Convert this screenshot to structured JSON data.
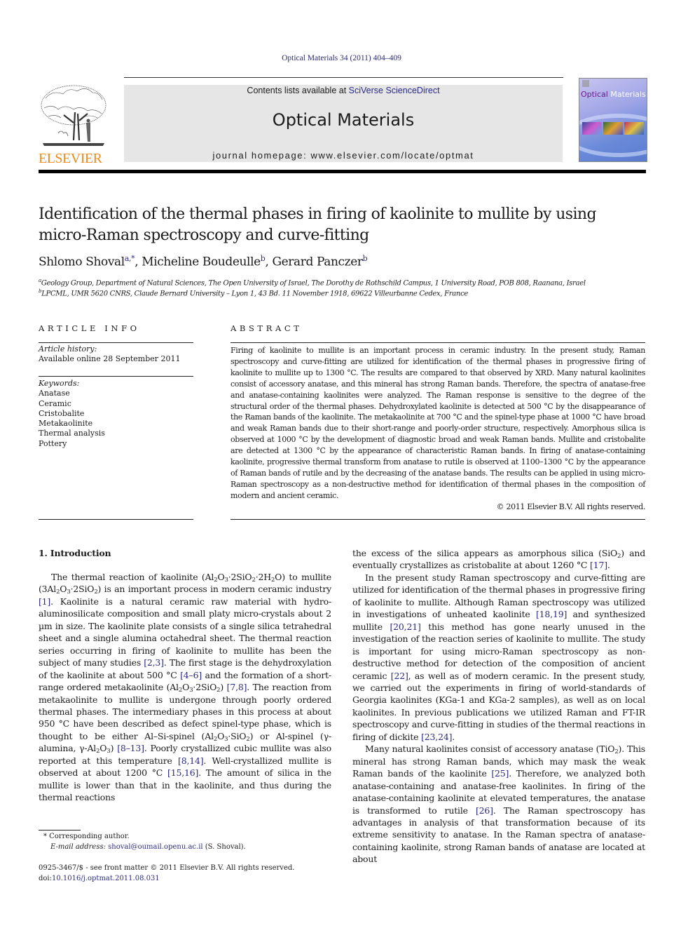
{
  "header": {
    "citation": "Optical Materials 34 (2011) 404–409",
    "contents_prefix": "Contents lists available at ",
    "contents_link": "SciVerse ScienceDirect",
    "journal_name": "Optical Materials",
    "homepage": "journal homepage: www.elsevier.com/locate/optmat",
    "publisher_logo_text": "ELSEVIER",
    "cover_title_part1": "Optical",
    "cover_title_part2": " Materials"
  },
  "colors": {
    "link": "#2a2a8a",
    "elsevier_orange": "#f08a1e",
    "banner_bg": "#e6e6e6"
  },
  "article": {
    "title_line1": "Identification of the thermal phases in firing of kaolinite to mullite by using",
    "title_line2": "micro-Raman spectroscopy and curve-fitting",
    "authors": [
      {
        "name": "Shlomo Shoval",
        "marks": "a,*",
        "sep": ", "
      },
      {
        "name": "Micheline Boudeulle",
        "marks": "b",
        "sep": ", "
      },
      {
        "name": "Gerard Panczer",
        "marks": "b",
        "sep": ""
      }
    ],
    "affiliations": [
      {
        "mark": "a",
        "text": "Geology Group, Department of Natural Sciences, The Open University of Israel, The Dorothy de Rothschild Campus, 1 University Road, POB 808, Raanana, Israel"
      },
      {
        "mark": "b",
        "text": "LPCML, UMR 5620 CNRS, Claude Bernard University – Lyon 1, 43 Bd. 11 November 1918, 69622 Villeurbanne Cedex, France"
      }
    ]
  },
  "article_info": {
    "heading": "ARTICLE INFO",
    "history_label": "Article history:",
    "history_value": "Available online 28 September 2011",
    "keywords_label": "Keywords:",
    "keywords": [
      "Anatase",
      "Ceramic",
      "Cristobalite",
      "Metakaolinite",
      "Thermal analysis",
      "Pottery"
    ]
  },
  "abstract": {
    "heading": "ABSTRACT",
    "text": "Firing of kaolinite to mullite is an important process in ceramic industry. In the present study, Raman spectroscopy and curve-fitting are utilized for identification of the thermal phases in progressive firing of kaolinite to mullite up to 1300 °C. The results are compared to that observed by XRD. Many natural kaolinites consist of accessory anatase, and this mineral has strong Raman bands. Therefore, the spectra of anatase-free and anatase-containing kaolinites were analyzed. The Raman response is sensitive to the degree of the structural order of the thermal phases. Dehydroxylated kaolinite is detected at 500 °C by the disappearance of the Raman bands of the kaolinite. The metakaolinite at 700 °C and the spinel-type phase at 1000 °C have broad and weak Raman bands due to their short-range and poorly-order structure, respectively. Amorphous silica is observed at 1000 °C by the development of diagnostic broad and weak Raman bands. Mullite and cristobalite are detected at 1300 °C by the appearance of characteristic Raman bands. In firing of anatase-containing kaolinite, progressive thermal transform from anatase to rutile is observed at 1100–1300 °C by the appearance of Raman bands of rutile and by the decreasing of the anatase bands. The results can be applied in using micro-Raman spectroscopy as a non-destructive method for identification of thermal phases in the composition of modern and ancient ceramic.",
    "copyright": "© 2011 Elsevier B.V. All rights reserved."
  },
  "body": {
    "section_heading": "1. Introduction",
    "left": {
      "p1_a": "The thermal reaction of kaolinite (Al",
      "p1_b": "O",
      "p1_c": "·2SiO",
      "p1_d": "·2H",
      "p1_e": "O) to mullite (3Al",
      "p1_f": "O",
      "p1_g": "·2SiO",
      "p1_h": ") is an important process in modern ceramic industry ",
      "ref1": "[1]",
      "p1_i": ". Kaolinite is a natural ceramic raw material with hydro-aluminosilicate composition and small platy micro-crystals about 2 µm in size. The kaolinite plate consists of a single silica tetrahedral sheet and a single alumina octahedral sheet. The thermal reaction series occurring in firing of kaolinite to mullite has been the subject of many studies ",
      "ref2": "[2,3]",
      "p1_j": ". The first stage is the dehydroxylation of the kaolinite at about 500 °C ",
      "ref3": "[4–6]",
      "p1_k": " and the formation of a short-range ordered metakaolinite (Al",
      "p1_l": "O",
      "p1_m": "·2SiO",
      "p1_n": ") ",
      "ref4": "[7,8]",
      "p1_o": ". The reaction from metakaolinite to mullite is undergone through poorly ordered thermal phases. The intermediary phases in this process at about 950 °C have been described as defect spinel-type phase, which is thought to be either Al–Si-spinel (Al",
      "p1_p": "O",
      "p1_q": "·SiO",
      "p1_r": ") or Al-spinel (γ-alumina, γ-Al",
      "p1_s": "O",
      "p1_t": ") ",
      "ref5": "[8–13]",
      "p1_u": ". Poorly crystallized cubic mullite was also reported at this temperature ",
      "ref6": "[8,14]",
      "p1_v": ". Well-crystallized mullite is observed at about 1200 °C ",
      "ref7": "[15,16]",
      "p1_w": ". The amount of silica in the mullite is lower than that in the kaolinite, and thus during the thermal reactions"
    },
    "right": {
      "p0_a": "the excess of the silica appears as amorphous silica (SiO",
      "p0_b": ") and eventually crystallizes as cristobalite at about 1260 °C ",
      "ref17": "[17]",
      "p0_c": ".",
      "p2_a": "In the present study Raman spectroscopy and curve-fitting are utilized for identification of the thermal phases in progressive firing of kaolinite to mullite. Although Raman spectroscopy was utilized in investigations of unheated kaolinite ",
      "ref18": "[18,19]",
      "p2_b": " and synthesized mullite ",
      "ref20": "[20,21]",
      "p2_c": " this method has gone nearly unused in the investigation of the reaction series of kaolinite to mullite. The study is important for using micro-Raman spectroscopy as non-destructive method for detection of the composition of ancient ceramic ",
      "ref22": "[22]",
      "p2_d": ", as well as of modern ceramic. In the present study, we carried out the experiments in firing of world-standards of Georgia kaolinites (KGa-1 and KGa-2 samples), as well as on local kaolinites. In previous publications we utilized Raman and FT-IR spectroscopy and curve-fitting in studies of the thermal reactions in firing of dickite ",
      "ref23": "[23,24]",
      "p2_e": ".",
      "p3_a": "Many natural kaolinites consist of accessory anatase (TiO",
      "p3_b": "). This mineral has strong Raman bands, which may mask the weak Raman bands of the kaolinite ",
      "ref25": "[25]",
      "p3_c": ". Therefore, we analyzed both anatase-containing and anatase-free kaolinites. In firing of the anatase-containing kaolinite at elevated temperatures, the anatase is transformed to rutile ",
      "ref26": "[26]",
      "p3_d": ". The Raman spectroscopy has advantages in analysis of that transformation because of its extreme sensitivity to anatase. In the Raman spectra of anatase-containing kaolinite, strong Raman bands of anatase are located at about"
    }
  },
  "footnote": {
    "corresponding": "* Corresponding author.",
    "email_label": "E-mail address: ",
    "email": "shoval@oumail.openu.ac.il",
    "email_suffix": " (S. Shoval)."
  },
  "front_matter": {
    "issn_line": "0925-3467/$ - see front matter © 2011 Elsevier B.V. All rights reserved.",
    "doi_label": "doi:",
    "doi": "10.1016/j.optmat.2011.08.031"
  }
}
